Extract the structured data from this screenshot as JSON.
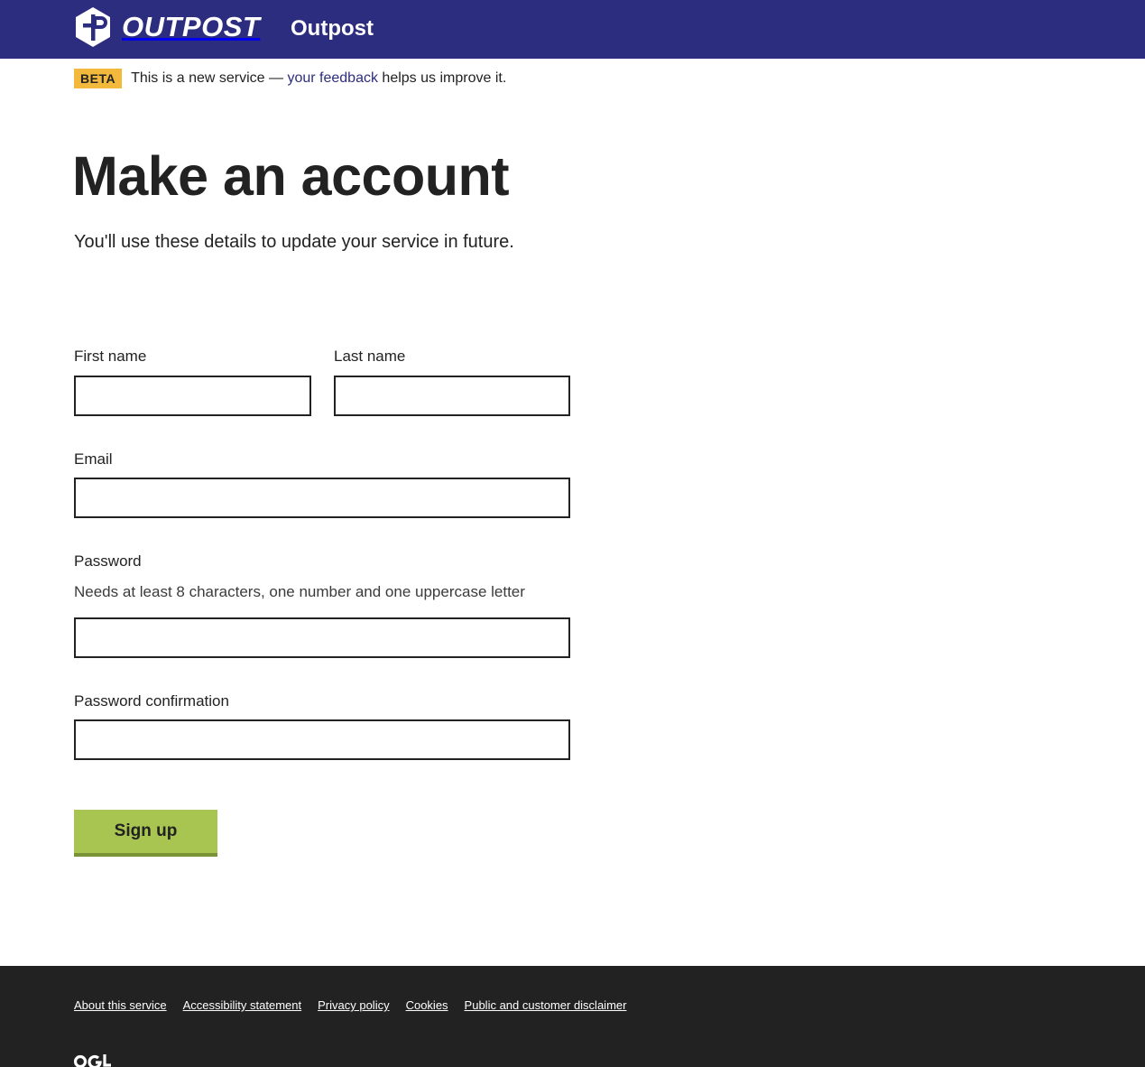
{
  "header": {
    "logo_text": "OUTPOST",
    "service_name": "Outpost"
  },
  "phase_banner": {
    "tag": "BETA",
    "text_before": "This is a new service — ",
    "link": "your feedback",
    "text_after": " helps us improve it."
  },
  "page": {
    "title": "Make an account",
    "lede": "You'll use these details to update your service in future."
  },
  "form": {
    "first_name": {
      "label": "First name",
      "value": ""
    },
    "last_name": {
      "label": "Last name",
      "value": ""
    },
    "email": {
      "label": "Email",
      "value": ""
    },
    "password": {
      "label": "Password",
      "hint": "Needs at least 8 characters, one number and one uppercase letter",
      "value": ""
    },
    "password_confirmation": {
      "label": "Password confirmation",
      "value": ""
    },
    "submit_label": "Sign up"
  },
  "footer": {
    "links": [
      "About this service",
      "Accessibility statement",
      "Privacy policy",
      "Cookies",
      "Public and customer disclaimer"
    ],
    "ogl_text": "OGL"
  },
  "colors": {
    "header_bg": "#2d2d7f",
    "beta_tag": "#f3b93c",
    "button_bg": "#a8c551",
    "footer_bg": "#222222"
  }
}
